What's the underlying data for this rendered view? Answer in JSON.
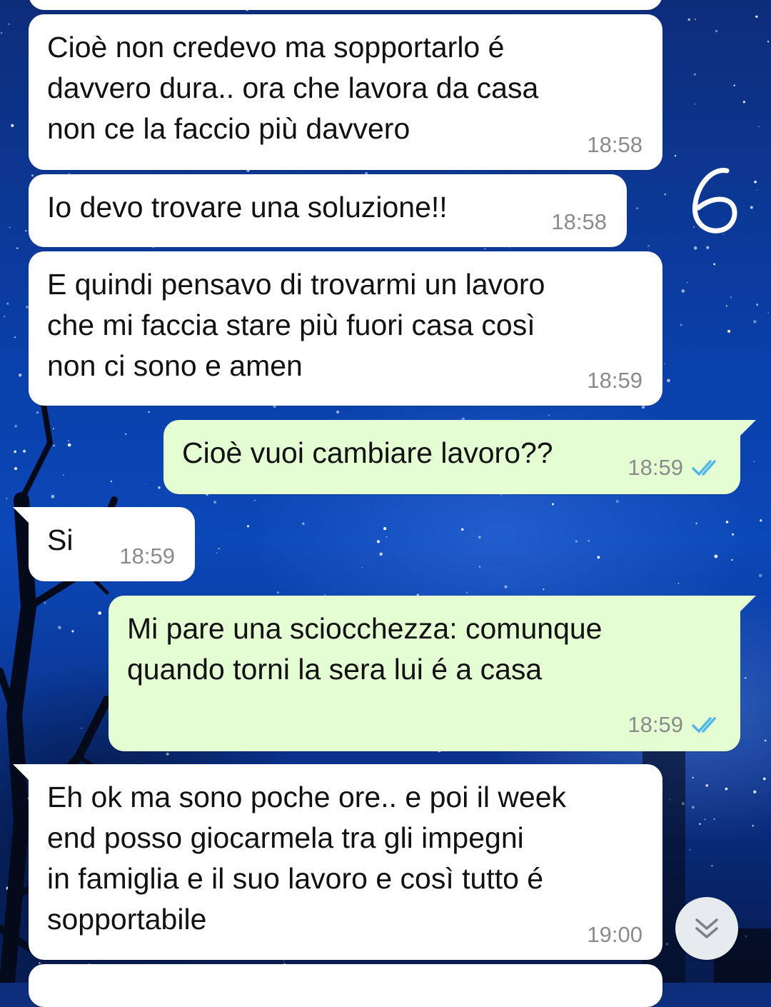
{
  "messages": [
    {
      "direction": "incoming",
      "text": "",
      "time": ""
    },
    {
      "direction": "incoming",
      "text": "Cioè non credevo ma sopportarlo é\ndavvero dura.. ora che lavora da casa\nnon ce la faccio più davvero",
      "time": "18:58"
    },
    {
      "direction": "incoming",
      "text": "Io devo trovare una soluzione!!",
      "time": "18:58"
    },
    {
      "direction": "incoming",
      "text": "E quindi pensavo di trovarmi un lavoro\nche mi faccia stare più fuori casa così\nnon ci sono e amen",
      "time": "18:59"
    },
    {
      "direction": "outgoing",
      "text": "Cioè vuoi cambiare lavoro??",
      "time": "18:59",
      "status": "read"
    },
    {
      "direction": "incoming",
      "text": "Si",
      "time": "18:59"
    },
    {
      "direction": "outgoing",
      "text": "Mi pare una sciocchezza: comunque\nquando torni la sera lui é a casa",
      "time": "18:59",
      "status": "read"
    },
    {
      "direction": "incoming",
      "text": "Eh ok ma sono poche ore.. e poi il week\nend posso giocarmela tra gli impegni\nin famiglia e il suo lavoro e così tutto é\nsopportabile",
      "time": "19:00"
    },
    {
      "direction": "incoming",
      "text": "",
      "time": ""
    }
  ],
  "annotation": {
    "text": "6"
  },
  "scroll_button": {
    "icon": "double-chevron-down-icon"
  },
  "colors": {
    "incoming_bubble": "#ffffff",
    "outgoing_bubble": "#e4fdd3",
    "read_ticks": "#4fb6ec",
    "timestamp": "#8b8b8b"
  }
}
